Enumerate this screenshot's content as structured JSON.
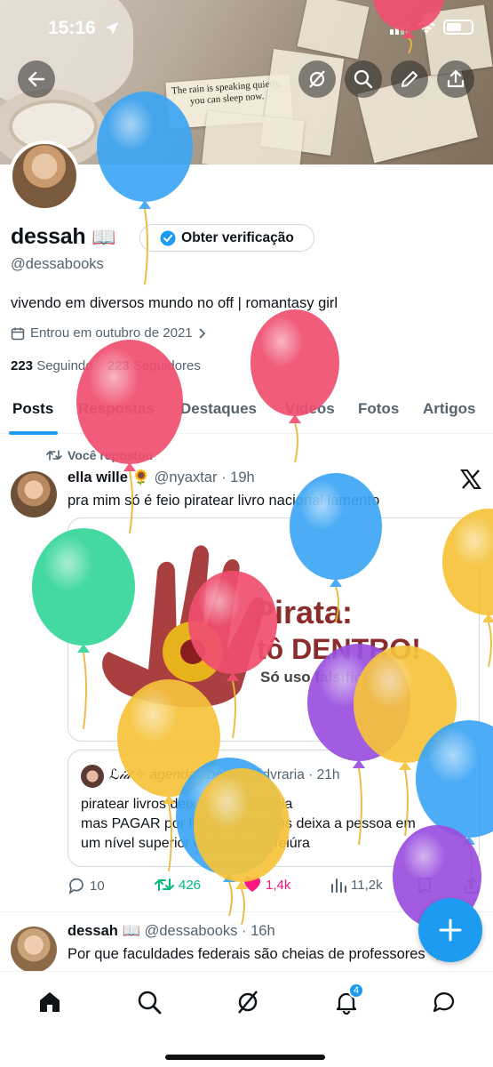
{
  "status_bar": {
    "time": "15:16"
  },
  "banner": {
    "paper_lines": [
      "The rain is speaking quietly,",
      "you can sleep now."
    ]
  },
  "profile": {
    "name": "dessah",
    "name_emoji": "📖",
    "verify_label": "Obter verificação",
    "handle": "@dessabooks",
    "bio": "vivendo em diversos mundo no off | romantasy girl",
    "joined": "Entrou em outubro de 2021",
    "following_count": "223",
    "following_label": "Seguindo",
    "followers_count": "223",
    "followers_label": "Seguidores"
  },
  "tabs": [
    "Posts",
    "Respostas",
    "Destaques",
    "Vídeos",
    "Fotos",
    "Artigos"
  ],
  "feed": {
    "repost_label": "Você repostou",
    "tweet1": {
      "name": "ella wille",
      "emoji": "🌻",
      "handle": "@nyaxtar",
      "time": "· 19h",
      "text": "pra mim só é feio piratear livro nacional lamento",
      "image": {
        "line1": "Pirata:",
        "line2": "tô DENTRO!",
        "line3": "Só uso falsificação"
      },
      "quote": {
        "name": "ℒ𝒾𝒹 ✧ agenda aberta",
        "handle": "@lidvraria",
        "time": "· 21h",
        "lines": [
          "piratear livros deixa a pessoa feia",
          "mas PAGAR por livros pirateados deixa a pessoa em",
          "um nível superior de burrice E feiúra"
        ]
      },
      "actions": {
        "replies": "10",
        "reposts": "426",
        "likes": "1,4k",
        "views": "11,2k"
      }
    },
    "tweet2": {
      "name": "dessah",
      "emoji": "📖",
      "handle": "@dessabooks",
      "time": "· 16h",
      "text": "Por que faculdades federais são cheias de professores"
    }
  },
  "nav": {
    "notifications_badge": "4"
  },
  "colors": {
    "accent": "#1d9bf0",
    "repost_green": "#00ba7c",
    "like_pink": "#f91880"
  },
  "balloon_colors": {
    "blue": "#3da6f5",
    "pink": "#f04f6f",
    "green": "#35d69a",
    "yellow": "#f6c33a",
    "purple": "#9a4fe0"
  }
}
